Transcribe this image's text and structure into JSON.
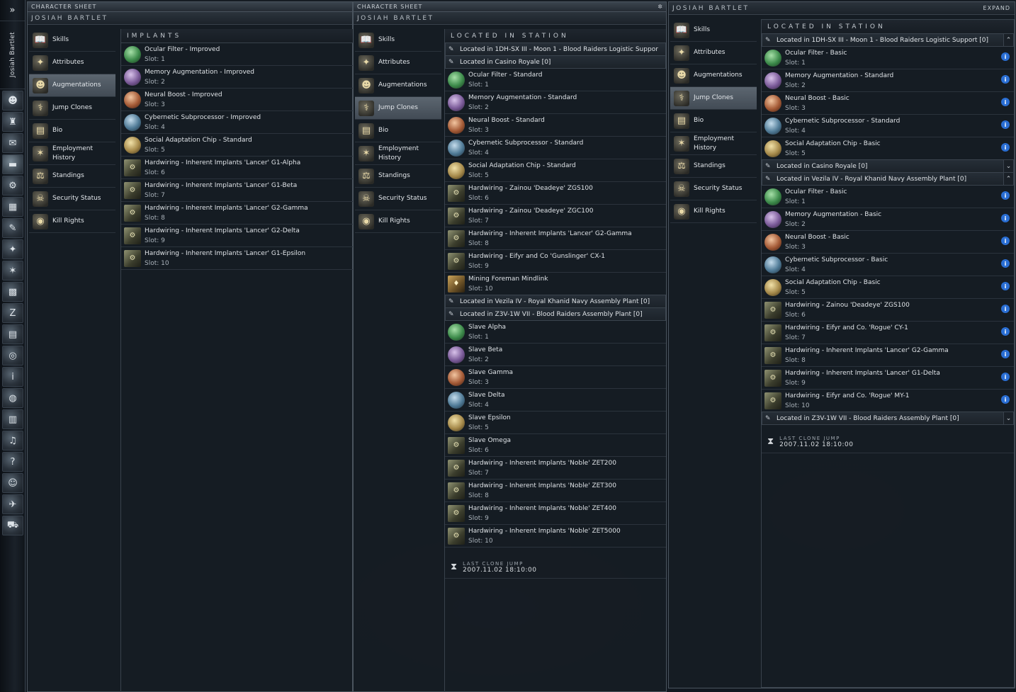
{
  "neocom": {
    "top_glyph": "»",
    "pilot_name": "Josiah Bartlet",
    "buttons": [
      "☻",
      "♜",
      "✉",
      "▬",
      "⚙",
      "▦",
      "✎",
      "✦",
      "✶",
      "▩",
      "Z",
      "▤",
      "◎",
      "i",
      "◍",
      "▥",
      "♫",
      "?",
      "☺",
      "✈",
      "⛟"
    ]
  },
  "windows": [
    {
      "caption": "CHARACTER SHEET",
      "title": "JOSIAH BARTLET",
      "panel_title": "IMPLANTS",
      "nav": [
        {
          "label": "Skills",
          "icon": "📖"
        },
        {
          "label": "Attributes",
          "icon": "✦"
        },
        {
          "label": "Augmentations",
          "icon": "☻",
          "active": true
        },
        {
          "label": "Jump Clones",
          "icon": "⚕"
        },
        {
          "label": "Bio",
          "icon": "▤"
        },
        {
          "label": "Employment History",
          "icon": "✶"
        },
        {
          "label": "Standings",
          "icon": "⚖"
        },
        {
          "label": "Security Status",
          "icon": "☠"
        },
        {
          "label": "Kill Rights",
          "icon": "◉"
        }
      ],
      "implants": [
        {
          "name": "Ocular Filter - Improved",
          "slot": "Slot: 1",
          "icon": "ic-green"
        },
        {
          "name": "Memory Augmentation - Improved",
          "slot": "Slot: 2",
          "icon": "ic-purple"
        },
        {
          "name": "Neural Boost - Improved",
          "slot": "Slot: 3",
          "icon": "ic-orange"
        },
        {
          "name": "Cybernetic Subprocessor - Improved",
          "slot": "Slot: 4",
          "icon": "ic-blue"
        },
        {
          "name": "Social Adaptation Chip - Standard",
          "slot": "Slot: 5",
          "icon": "ic-gold"
        },
        {
          "name": "Hardwiring - Inherent Implants 'Lancer' G1-Alpha",
          "slot": "Slot: 6",
          "icon": "ic-hw"
        },
        {
          "name": "Hardwiring - Inherent Implants 'Lancer' G1-Beta",
          "slot": "Slot: 7",
          "icon": "ic-hw"
        },
        {
          "name": "Hardwiring - Inherent Implants 'Lancer' G2-Gamma",
          "slot": "Slot: 8",
          "icon": "ic-hw"
        },
        {
          "name": "Hardwiring - Inherent Implants 'Lancer' G2-Delta",
          "slot": "Slot: 9",
          "icon": "ic-hw"
        },
        {
          "name": "Hardwiring - Inherent Implants 'Lancer' G1-Epsilon",
          "slot": "Slot: 10",
          "icon": "ic-hw"
        }
      ]
    },
    {
      "caption": "CHARACTER SHEET",
      "title": "JOSIAH BARTLET",
      "panel_title": "LOCATED IN STATION",
      "nav_active": "Jump Clones",
      "locations": [
        {
          "label": "Located in 1DH-SX III - Moon 1 - Blood Raiders Logistic Suppor",
          "items": []
        },
        {
          "label": "Located in Casino Royale [0]",
          "items": [
            {
              "name": "Ocular Filter - Standard",
              "slot": "Slot: 1",
              "icon": "ic-green"
            },
            {
              "name": "Memory Augmentation - Standard",
              "slot": "Slot: 2",
              "icon": "ic-purple"
            },
            {
              "name": "Neural Boost - Standard",
              "slot": "Slot: 3",
              "icon": "ic-orange"
            },
            {
              "name": "Cybernetic Subprocessor - Standard",
              "slot": "Slot: 4",
              "icon": "ic-blue"
            },
            {
              "name": "Social Adaptation Chip - Standard",
              "slot": "Slot: 5",
              "icon": "ic-gold"
            },
            {
              "name": "Hardwiring - Zainou 'Deadeye' ZGS100",
              "slot": "Slot: 6",
              "icon": "ic-hw"
            },
            {
              "name": "Hardwiring - Zainou 'Deadeye' ZGC100",
              "slot": "Slot: 7",
              "icon": "ic-hw"
            },
            {
              "name": "Hardwiring - Inherent Implants 'Lancer' G2-Gamma",
              "slot": "Slot: 8",
              "icon": "ic-hw"
            },
            {
              "name": "Hardwiring - Eifyr and Co 'Gunslinger' CX-1",
              "slot": "Slot: 9",
              "icon": "ic-hw"
            },
            {
              "name": "Mining Foreman Mindlink",
              "slot": "Slot: 10",
              "icon": "ic-mining"
            }
          ]
        },
        {
          "label": "Located in Vezila IV - Royal Khanid Navy Assembly Plant [0]",
          "items": []
        },
        {
          "label": "Located in Z3V-1W VII - Blood Raiders Assembly Plant [0]",
          "items": [
            {
              "name": "Slave Alpha",
              "slot": "Slot: 1",
              "icon": "ic-green"
            },
            {
              "name": "Slave Beta",
              "slot": "Slot: 2",
              "icon": "ic-purple"
            },
            {
              "name": "Slave Gamma",
              "slot": "Slot: 3",
              "icon": "ic-orange"
            },
            {
              "name": "Slave Delta",
              "slot": "Slot: 4",
              "icon": "ic-blue"
            },
            {
              "name": "Slave Epsilon",
              "slot": "Slot: 5",
              "icon": "ic-gold"
            },
            {
              "name": "Slave Omega",
              "slot": "Slot: 6",
              "icon": "ic-hw"
            },
            {
              "name": "Hardwiring - Inherent Implants 'Noble' ZET200",
              "slot": "Slot: 7",
              "icon": "ic-hw"
            },
            {
              "name": "Hardwiring - Inherent Implants 'Noble' ZET300",
              "slot": "Slot: 8",
              "icon": "ic-hw"
            },
            {
              "name": "Hardwiring - Inherent Implants 'Noble' ZET400",
              "slot": "Slot: 9",
              "icon": "ic-hw"
            },
            {
              "name": "Hardwiring - Inherent Implants 'Noble' ZET5000",
              "slot": "Slot: 10",
              "icon": "ic-hw"
            }
          ]
        }
      ],
      "last_clone_jump_label": "LAST CLONE JUMP",
      "last_clone_jump_value": "2007.11.02 18:10:00"
    },
    {
      "title": "JOSIAH BARTLET",
      "expand_label": "EXPAND",
      "panel_title": "LOCATED IN STATION",
      "nav_active": "Jump Clones",
      "locations": [
        {
          "label": "Located in 1DH-SX III - Moon 1 - Blood Raiders Logistic Support [0]",
          "toggle": "⌃",
          "items": [
            {
              "name": "Ocular Filter - Basic",
              "slot": "Slot: 1",
              "icon": "ic-green"
            },
            {
              "name": "Memory Augmentation - Standard",
              "slot": "Slot: 2",
              "icon": "ic-purple"
            },
            {
              "name": "Neural Boost - Basic",
              "slot": "Slot: 3",
              "icon": "ic-orange"
            },
            {
              "name": "Cybernetic Subprocessor - Standard",
              "slot": "Slot: 4",
              "icon": "ic-blue"
            },
            {
              "name": "Social Adaptation Chip - Basic",
              "slot": "Slot: 5",
              "icon": "ic-gold"
            }
          ]
        },
        {
          "label": "Located in Casino Royale [0]",
          "toggle": "⌄",
          "items": []
        },
        {
          "label": "Located in Vezila IV - Royal Khanid Navy Assembly Plant [0]",
          "toggle": "⌃",
          "items": [
            {
              "name": "Ocular Filter - Basic",
              "slot": "Slot: 1",
              "icon": "ic-green"
            },
            {
              "name": "Memory Augmentation - Basic",
              "slot": "Slot: 2",
              "icon": "ic-purple"
            },
            {
              "name": "Neural Boost - Basic",
              "slot": "Slot: 3",
              "icon": "ic-orange"
            },
            {
              "name": "Cybernetic Subprocessor - Basic",
              "slot": "Slot: 4",
              "icon": "ic-blue"
            },
            {
              "name": "Social Adaptation Chip - Basic",
              "slot": "Slot: 5",
              "icon": "ic-gold"
            },
            {
              "name": "Hardwiring - Zainou 'Deadeye' ZGS100",
              "slot": "Slot: 6",
              "icon": "ic-hw"
            },
            {
              "name": "Hardwiring - Eifyr and Co. 'Rogue' CY-1",
              "slot": "Slot: 7",
              "icon": "ic-hw"
            },
            {
              "name": "Hardwiring - Inherent Implants 'Lancer' G2-Gamma",
              "slot": "Slot: 8",
              "icon": "ic-hw"
            },
            {
              "name": "Hardwiring - Inherent Implants 'Lancer' G1-Delta",
              "slot": "Slot: 9",
              "icon": "ic-hw"
            },
            {
              "name": "Hardwiring - Eifyr and Co. 'Rogue' MY-1",
              "slot": "Slot: 10",
              "icon": "ic-hw"
            }
          ]
        },
        {
          "label": "Located in Z3V-1W VII - Blood Raiders Assembly Plant [0]",
          "toggle": "⌄",
          "items": []
        }
      ],
      "last_clone_jump_label": "LAST CLONE JUMP",
      "last_clone_jump_value": "2007.11.02 18:10:00"
    }
  ]
}
